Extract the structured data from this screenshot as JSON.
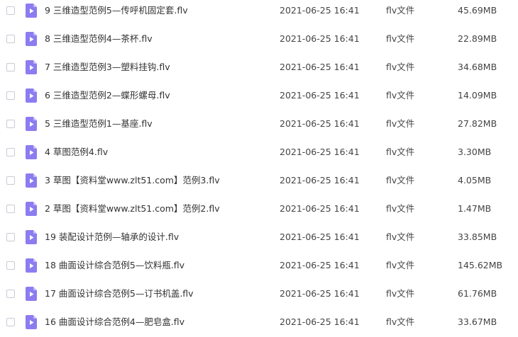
{
  "files": [
    {
      "name": "9 三维造型范例5—传呼机固定套.flv",
      "date": "2021-06-25 16:41",
      "type": "flv文件",
      "size": "45.69MB"
    },
    {
      "name": "8 三维造型范例4—茶杯.flv",
      "date": "2021-06-25 16:41",
      "type": "flv文件",
      "size": "22.89MB"
    },
    {
      "name": "7 三维造型范例3—塑料挂钩.flv",
      "date": "2021-06-25 16:41",
      "type": "flv文件",
      "size": "34.68MB"
    },
    {
      "name": "6 三维造型范例2—蝶形螺母.flv",
      "date": "2021-06-25 16:41",
      "type": "flv文件",
      "size": "14.09MB"
    },
    {
      "name": "5 三维造型范例1—基座.flv",
      "date": "2021-06-25 16:41",
      "type": "flv文件",
      "size": "27.82MB"
    },
    {
      "name": "4 草图范例4.flv",
      "date": "2021-06-25 16:41",
      "type": "flv文件",
      "size": "3.30MB"
    },
    {
      "name": "3 草图【资料堂www.zlt51.com】范例3.flv",
      "date": "2021-06-25 16:41",
      "type": "flv文件",
      "size": "4.05MB"
    },
    {
      "name": "2 草图【资料堂www.zlt51.com】范例2.flv",
      "date": "2021-06-25 16:41",
      "type": "flv文件",
      "size": "1.47MB"
    },
    {
      "name": "19 装配设计范例—轴承的设计.flv",
      "date": "2021-06-25 16:41",
      "type": "flv文件",
      "size": "33.85MB"
    },
    {
      "name": "18 曲面设计综合范例5—饮料瓶.flv",
      "date": "2021-06-25 16:41",
      "type": "flv文件",
      "size": "145.62MB"
    },
    {
      "name": "17 曲面设计综合范例5—订书机盖.flv",
      "date": "2021-06-25 16:41",
      "type": "flv文件",
      "size": "61.76MB"
    },
    {
      "name": "16 曲面设计综合范例4—肥皂盒.flv",
      "date": "2021-06-25 16:41",
      "type": "flv文件",
      "size": "33.67MB"
    }
  ],
  "icon": {
    "name": "video-file-icon",
    "color": "#8c7cf0",
    "fold_color": "#c4baf8"
  }
}
